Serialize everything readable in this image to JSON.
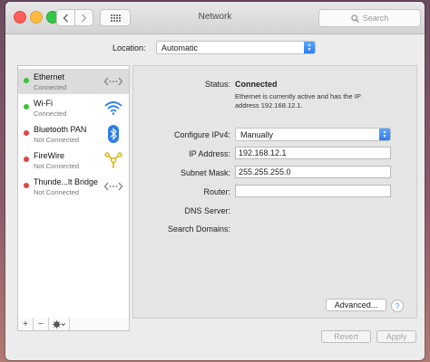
{
  "window": {
    "title": "Network"
  },
  "toolbar": {
    "search_placeholder": "Search"
  },
  "location": {
    "label": "Location:",
    "value": "Automatic"
  },
  "services": [
    {
      "name": "Ethernet",
      "status": "Connected",
      "status_color": "#3cc13b",
      "icon": "ethernet-icon"
    },
    {
      "name": "Wi-Fi",
      "status": "Connected",
      "status_color": "#3cc13b",
      "icon": "wifi-icon"
    },
    {
      "name": "Bluetooth PAN",
      "status": "Not Connected",
      "status_color": "#e0443c",
      "icon": "bluetooth-icon"
    },
    {
      "name": "FireWire",
      "status": "Not Connected",
      "status_color": "#e0443c",
      "icon": "firewire-icon"
    },
    {
      "name": "Thunde...lt Bridge",
      "status": "Not Connected",
      "status_color": "#e0443c",
      "icon": "thunderbolt-bridge-icon"
    }
  ],
  "sidebar_footer": {
    "add": "+",
    "remove": "−"
  },
  "detail": {
    "status_label": "Status:",
    "status_value": "Connected",
    "status_desc_1": "Ethernet is currently active and has the IP",
    "status_desc_2": "address 192.168.12.1.",
    "configure_label": "Configure IPv4:",
    "configure_value": "Manually",
    "ip_label": "IP Address:",
    "ip_value": "192.168.12.1",
    "subnet_label": "Subnet Mask:",
    "subnet_value": "255.255.255.0",
    "router_label": "Router:",
    "router_value": "",
    "dns_label": "DNS Server:",
    "domains_label": "Search Domains:",
    "advanced_button": "Advanced...",
    "help": "?"
  },
  "footer": {
    "revert": "Revert",
    "apply": "Apply"
  },
  "colors": {
    "accent": "#2d7de8",
    "connected": "#3cc13b",
    "not_connected": "#e0443c"
  }
}
